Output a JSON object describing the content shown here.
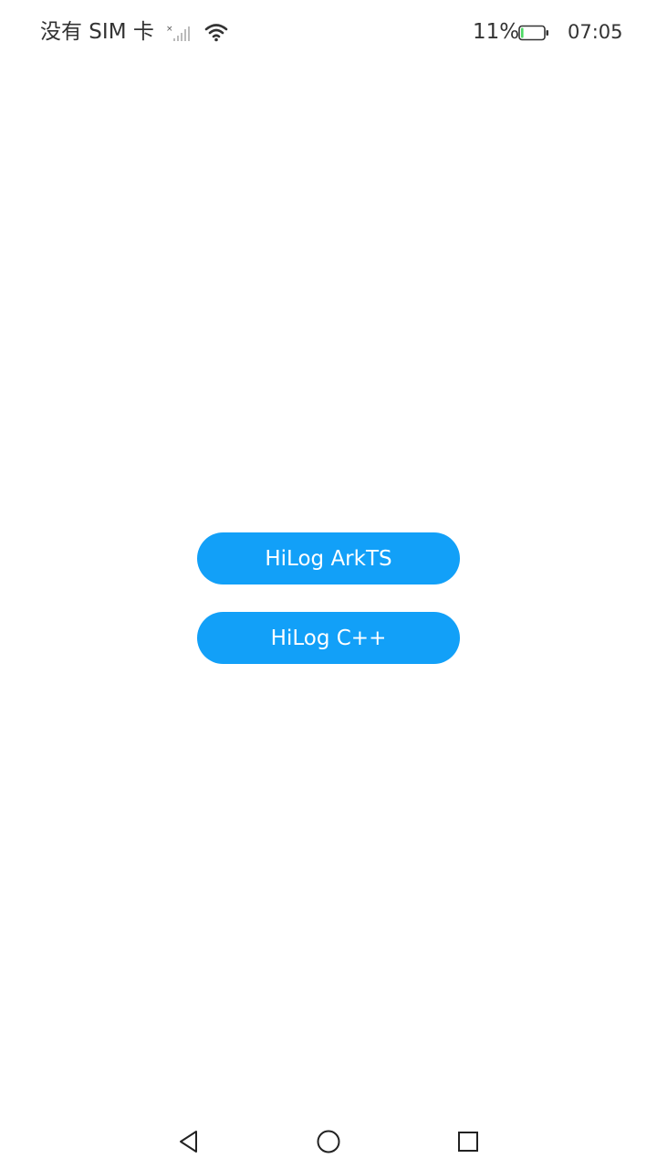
{
  "status_bar": {
    "carrier": "没有 SIM 卡",
    "signal_icon": "signal-no-sim-icon",
    "wifi_icon": "wifi-icon",
    "battery_percent": "11%",
    "battery_icon": "battery-icon",
    "battery_level": 0.11,
    "time": "07:05"
  },
  "main": {
    "buttons": [
      {
        "label": "HiLog ArkTS"
      },
      {
        "label": "HiLog C++"
      }
    ]
  },
  "nav_bar": {
    "back_icon": "back-triangle-icon",
    "home_icon": "home-circle-icon",
    "recent_icon": "recent-square-icon"
  },
  "colors": {
    "accent": "#12a0f8",
    "status_text": "#333333",
    "battery_fill": "#4cd964"
  }
}
